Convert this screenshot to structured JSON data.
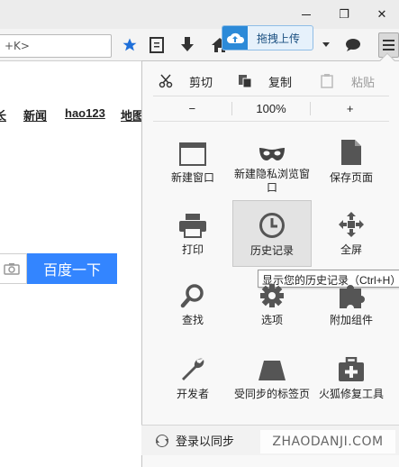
{
  "window": {
    "restore_glyph": "❐",
    "close_glyph": "✕"
  },
  "toolbar": {
    "url_fragment": "+K>",
    "icons": [
      "bookmark-star-icon",
      "reading-list-icon",
      "download-icon",
      "home-icon",
      "dropdown-arrow-icon",
      "chat-bubble-icon",
      "hamburger-menu-icon"
    ]
  },
  "upload_widget": {
    "label": "拖拽上传"
  },
  "page": {
    "nav_links": [
      "长",
      "新闻",
      "hao123",
      "地图"
    ],
    "search_button": "百度一下"
  },
  "menu": {
    "edit": {
      "cut": "剪切",
      "copy": "复制",
      "paste": "粘贴"
    },
    "zoom": {
      "minus": "−",
      "level": "100%",
      "plus": "+"
    },
    "items": [
      {
        "label": "新建窗口",
        "icon": "new-window-icon"
      },
      {
        "label": "新建隐私浏览窗口",
        "icon": "private-mask-icon"
      },
      {
        "label": "保存页面",
        "icon": "save-page-icon"
      },
      {
        "label": "打印",
        "icon": "printer-icon"
      },
      {
        "label": "历史记录",
        "icon": "history-clock-icon"
      },
      {
        "label": "全屏",
        "icon": "fullscreen-icon"
      },
      {
        "label": "查找",
        "icon": "find-magnifier-icon"
      },
      {
        "label": "选项",
        "icon": "options-gear-icon"
      },
      {
        "label": "附加组件",
        "icon": "addons-puzzle-icon"
      },
      {
        "label": "开发者",
        "icon": "developer-wrench-icon"
      },
      {
        "label": "受同步的标签页",
        "icon": "synced-tabs-icon"
      },
      {
        "label": "火狐修复工具",
        "icon": "repair-toolkit-icon"
      }
    ],
    "tooltip": "显示您的历史记录（Ctrl+H）",
    "footer": "登录以同步"
  },
  "watermark": "ZHAODANJI.COM",
  "colors": {
    "search_blue": "#3385ff",
    "toolbar_blue": "#1e6fd9",
    "panel_bg": "#f8f8f8"
  }
}
